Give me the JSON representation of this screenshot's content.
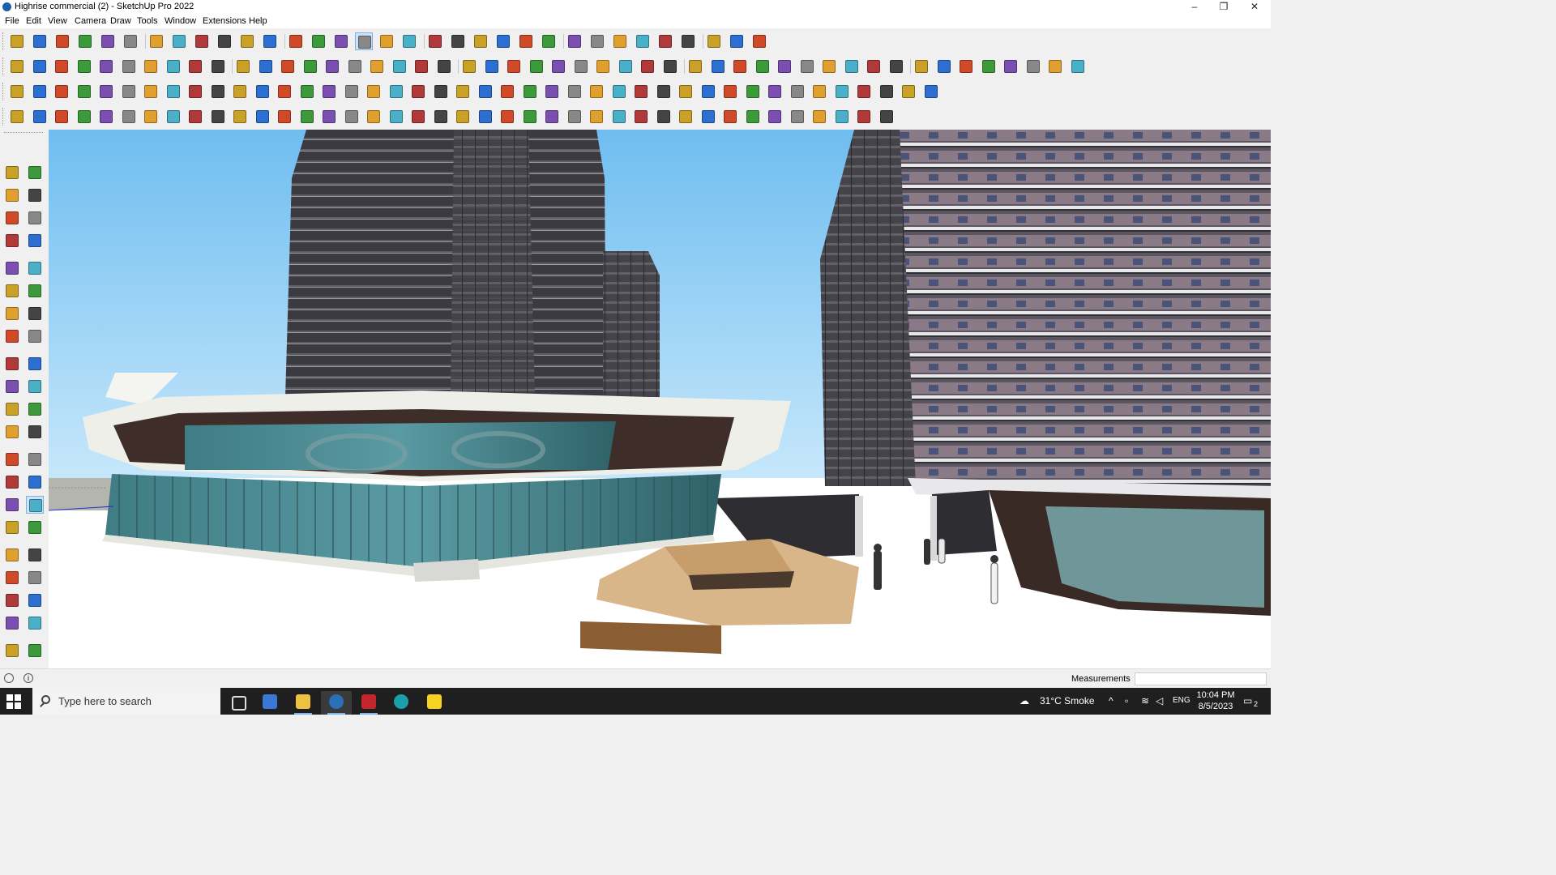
{
  "window": {
    "title": "Highrise commercial (2) - SketchUp Pro 2022",
    "minimize": "–",
    "maximize": "❐",
    "close": "✕"
  },
  "menu": [
    "File",
    "Edit",
    "View",
    "Camera",
    "Draw",
    "Tools",
    "Window",
    "Extensions",
    "Help"
  ],
  "toolbars": {
    "row1": [
      "zoom-extents",
      "select",
      "eraser",
      "pencil",
      "freehand",
      "rectangle",
      "push-pull",
      "follow-me",
      "move",
      "rotate",
      "scale",
      "tape-measure",
      "text",
      "paint-bucket",
      "orbit",
      "pan",
      "zoom",
      "zoom-window",
      "section-plane",
      "display-section",
      "section-fill",
      "display-section-cuts",
      "walkthrough",
      "warehouse",
      "extension-warehouse",
      "send-to-layout",
      "push-pull-up",
      "push-pull-down",
      "axes",
      "style",
      "undo",
      "redo",
      "dimension"
    ],
    "row2_count": 48,
    "row3_count": 42,
    "row4_count": 40,
    "active_tool": "pan"
  },
  "left_toolbar": {
    "tools": [
      "select",
      "orbit",
      "paint-bucket",
      "eraser",
      "component",
      "tape",
      "line",
      "freehand",
      "rectangle",
      "rotated-rect",
      "circle",
      "polygon",
      "arc",
      "two-point-arc",
      "pie",
      "three-point-arc",
      "move",
      "push-pull",
      "rotate",
      "follow-me",
      "scale",
      "offset",
      "tape-measure",
      "dimension",
      "protractor",
      "text",
      "axes",
      "3d-text",
      "orbit-2",
      "pan",
      "zoom",
      "zoom-window",
      "zoom-extents",
      "previous",
      "position-camera",
      "look-around",
      "walk",
      "section",
      "section-plane",
      "display-section",
      "section-fill",
      "section-cuts"
    ],
    "active": "pan"
  },
  "status": {
    "measurements_label": "Measurements",
    "measurements_value": ""
  },
  "taskbar": {
    "search_placeholder": "Type here to search",
    "weather": "31°C  Smoke",
    "language": "ENG",
    "time": "10:04 PM",
    "date": "8/5/2023",
    "notification_count": "2"
  },
  "colors": {
    "sky": "#78c3f0",
    "tower": "#3d3c41",
    "glass": "#477f86",
    "ground": "#ffffff",
    "accent": "#1b5fa8"
  }
}
